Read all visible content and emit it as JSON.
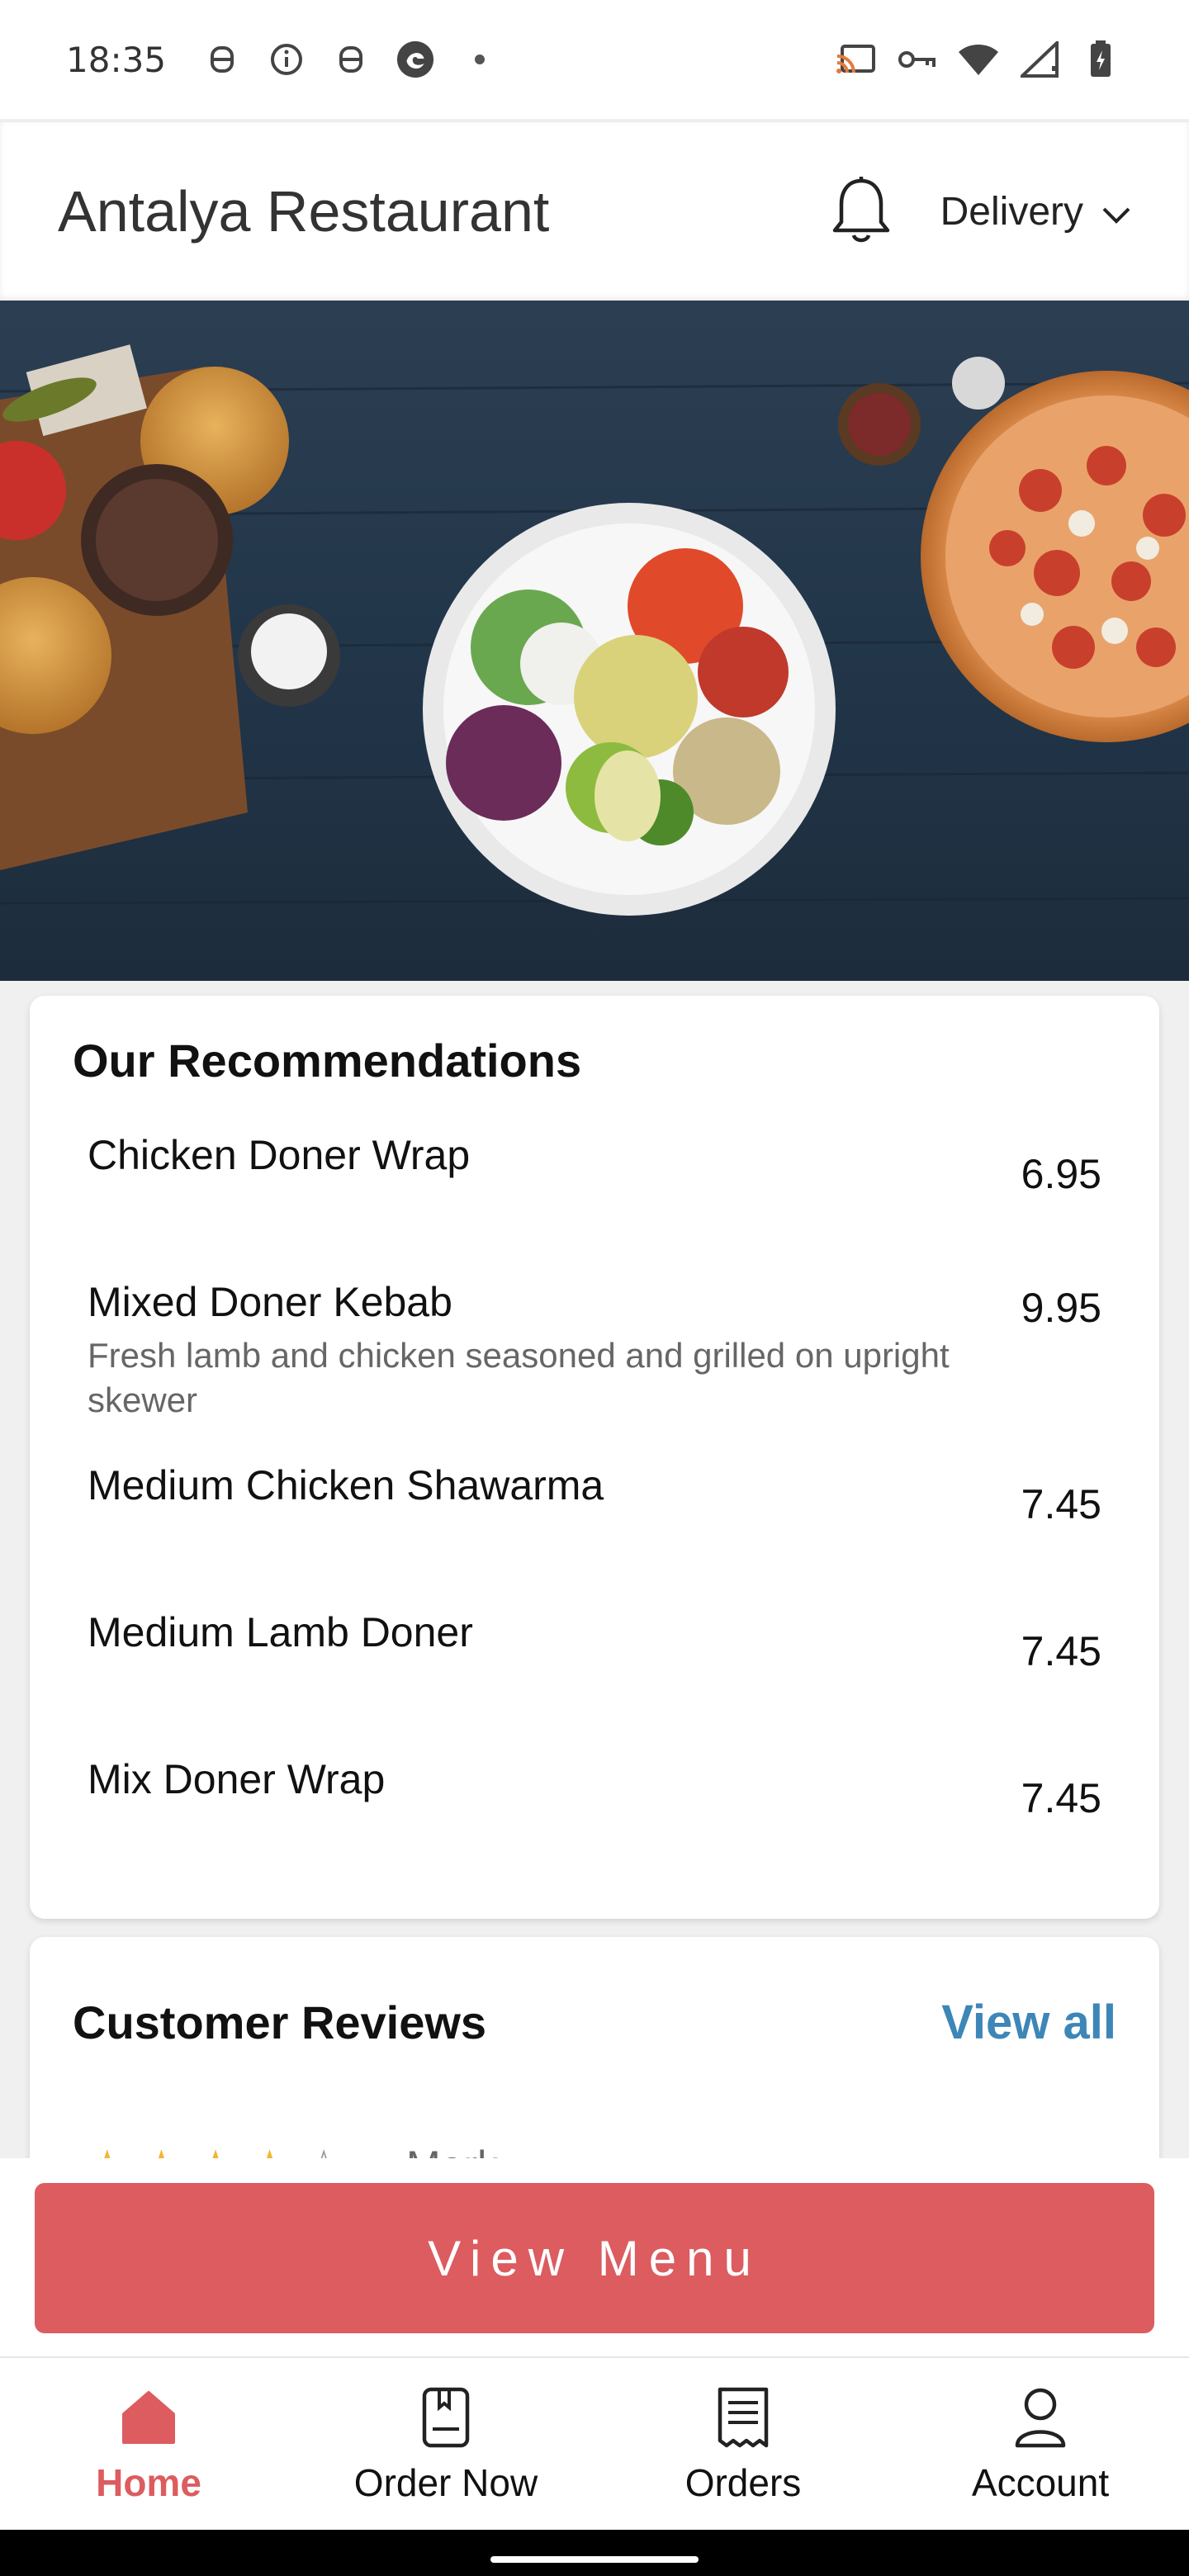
{
  "status_bar": {
    "time": "18:35",
    "left_icons": [
      "notification-icon",
      "info-icon",
      "notification-icon",
      "app-icon",
      "dot-icon"
    ],
    "right_icons": [
      "cast-icon",
      "vpn-key-icon",
      "wifi-icon",
      "signal-icon",
      "battery-icon"
    ]
  },
  "header": {
    "title": "Antalya Restaurant",
    "mode": "Delivery"
  },
  "recommendations": {
    "title": "Our Recommendations",
    "items": [
      {
        "name": "Chicken Doner Wrap",
        "description": "",
        "price": "6.95"
      },
      {
        "name": "Mixed Doner Kebab",
        "description": "Fresh lamb and chicken seasoned and grilled on upright skewer",
        "price": "9.95"
      },
      {
        "name": "Medium Chicken Shawarma",
        "description": "",
        "price": "7.45"
      },
      {
        "name": "Medium Lamb Doner",
        "description": "",
        "price": "7.45"
      },
      {
        "name": "Mix Doner Wrap",
        "description": "",
        "price": "7.45"
      }
    ]
  },
  "reviews": {
    "title": "Customer Reviews",
    "view_all": "View all",
    "first_rating": 4,
    "first_reviewer_partial": "Mark"
  },
  "view_menu_label": "View Menu",
  "nav": {
    "items": [
      {
        "label": "Home",
        "icon": "home-icon",
        "active": true
      },
      {
        "label": "Order Now",
        "icon": "order-book-icon",
        "active": false
      },
      {
        "label": "Orders",
        "icon": "receipt-icon",
        "active": false
      },
      {
        "label": "Account",
        "icon": "person-icon",
        "active": false
      }
    ]
  },
  "colors": {
    "accent": "#dc5c60",
    "link": "#3d86b7",
    "star": "#f2b632"
  }
}
